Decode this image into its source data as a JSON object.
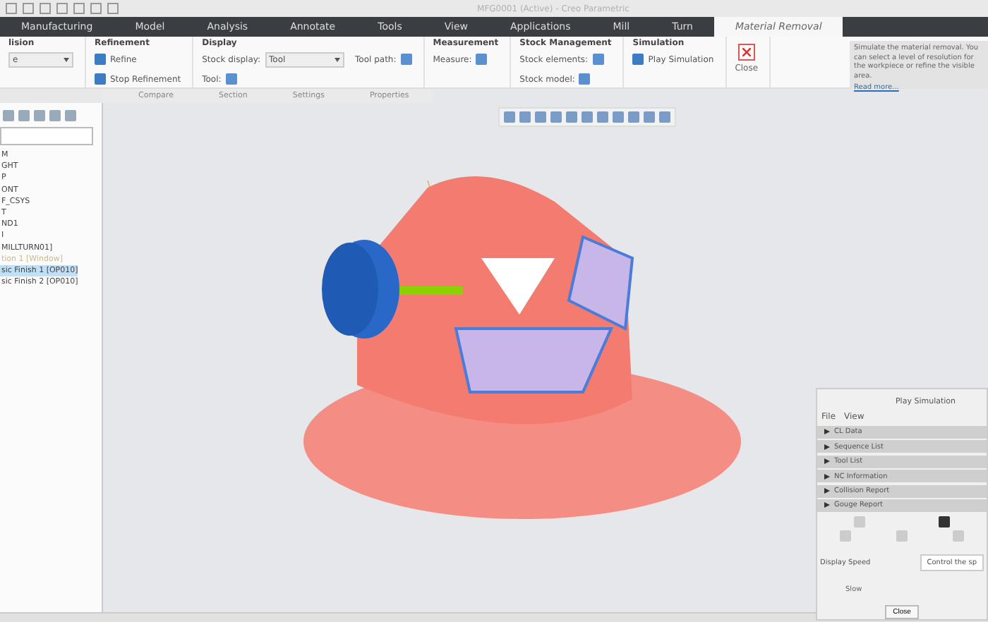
{
  "window": {
    "title": "MFG0001 (Active) - Creo Parametric"
  },
  "menu_tabs": [
    {
      "label": "Manufacturing",
      "selected": false
    },
    {
      "label": "Model",
      "selected": false
    },
    {
      "label": "Analysis",
      "selected": false
    },
    {
      "label": "Annotate",
      "selected": false
    },
    {
      "label": "Tools",
      "selected": false
    },
    {
      "label": "View",
      "selected": false
    },
    {
      "label": "Applications",
      "selected": false
    },
    {
      "label": "Mill",
      "selected": false
    },
    {
      "label": "Turn",
      "selected": false
    },
    {
      "label": "Material Removal",
      "selected": true
    }
  ],
  "ribbon": {
    "groups": [
      {
        "title": "lision",
        "items": [
          {
            "kind": "dropdown",
            "value": "e"
          }
        ]
      },
      {
        "title": "Refinement",
        "items": [
          {
            "kind": "button",
            "label": "Refine"
          },
          {
            "kind": "button",
            "label": "Stop Refinement"
          }
        ]
      },
      {
        "title": "Display",
        "items": [
          {
            "kind": "dropdown",
            "label": "Stock display:",
            "value": "Tool"
          },
          {
            "kind": "tool",
            "label": "Tool:"
          },
          {
            "kind": "tool",
            "label": "Tool path:"
          }
        ]
      },
      {
        "title": "Measurement",
        "items": [
          {
            "kind": "tool",
            "label": "Measure:"
          }
        ]
      },
      {
        "title": "Stock Management",
        "items": [
          {
            "kind": "tool",
            "label": "Stock elements:"
          },
          {
            "kind": "tool",
            "label": "Stock model:"
          }
        ]
      },
      {
        "title": "Simulation",
        "items": [
          {
            "kind": "button",
            "label": "Play Simulation"
          }
        ]
      },
      {
        "items": [
          {
            "kind": "close",
            "label": "Close"
          }
        ]
      }
    ]
  },
  "help_tip": {
    "text": "Simulate the material removal. You can select a level of resolution for the workpiece or refine the visible area.",
    "link": "Read more..."
  },
  "sub_tabs": [
    "Compare",
    "Section",
    "Settings",
    "Properties"
  ],
  "tree": {
    "items": [
      {
        "label": "M",
        "selected": false,
        "disabled": false
      },
      {
        "label": "GHT",
        "selected": false,
        "disabled": false
      },
      {
        "label": "P",
        "selected": false,
        "disabled": false
      },
      {
        "label": "ONT",
        "selected": false,
        "disabled": false
      },
      {
        "label": "F_CSYS",
        "selected": false,
        "disabled": false
      },
      {
        "label": "T",
        "selected": false,
        "disabled": false
      },
      {
        "label": "ND1",
        "selected": false,
        "disabled": false
      },
      {
        "label": "I",
        "selected": false,
        "disabled": false
      },
      {
        "label": "MILLTURN01]",
        "selected": false,
        "disabled": false
      },
      {
        "label": "tion 1 [Window]",
        "selected": false,
        "disabled": true
      },
      {
        "label": "sic Finish 1 [OP010]",
        "selected": true,
        "disabled": false
      },
      {
        "label": "sic Finish 2 [OP010]",
        "selected": false,
        "disabled": false
      }
    ]
  },
  "play_simulation": {
    "title": "Play Simulation",
    "menu": [
      "File",
      "View"
    ],
    "sections": [
      {
        "label": "CL Data",
        "expanded": false
      },
      {
        "label": "Sequence List",
        "expanded": false
      },
      {
        "label": "Tool List",
        "expanded": false
      },
      {
        "label": "NC Information",
        "expanded": false
      },
      {
        "label": "Collision Report",
        "expanded": false
      },
      {
        "label": "Gouge Report",
        "expanded": false
      }
    ],
    "speed_label": "Display Speed",
    "tooltip": "Control the sp",
    "slow_label": "Slow",
    "button": "Close"
  }
}
